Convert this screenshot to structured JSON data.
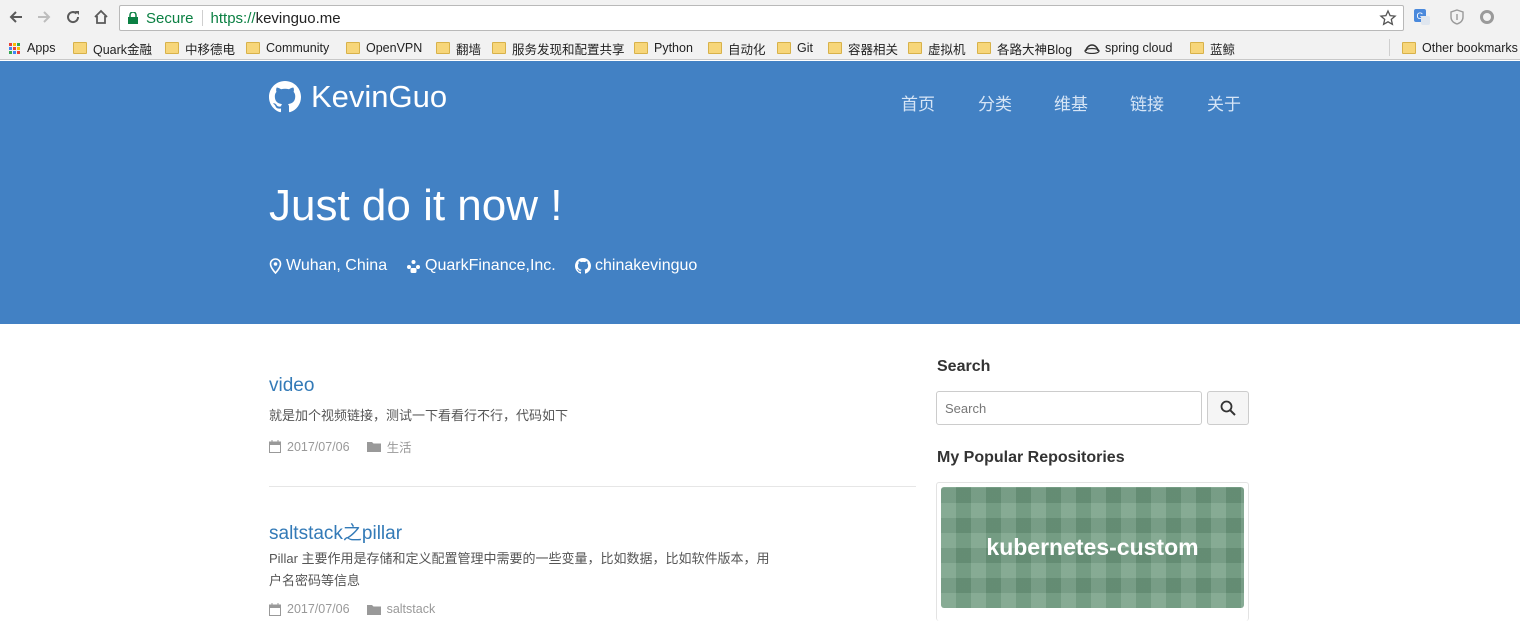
{
  "browser": {
    "secure_label": "Secure",
    "url_scheme": "https://",
    "url_host": "kevinguo.me",
    "bookmarks": [
      "Apps",
      "Quark金融",
      "中移德电",
      "Community",
      "OpenVPN",
      "翻墙",
      "服务发现和配置共享",
      "Python",
      "自动化",
      "Git",
      "容器相关",
      "虚拟机",
      "各路大神Blog",
      "spring cloud",
      "蓝鲸"
    ],
    "other_bookmarks": "Other bookmarks"
  },
  "site": {
    "brand": "KevinGuo",
    "nav": [
      "首页",
      "分类",
      "维基",
      "链接",
      "关于"
    ],
    "slogan": "Just do it now !",
    "location": "Wuhan, China",
    "company": "QuarkFinance,Inc.",
    "github": "chinakevinguo"
  },
  "posts": [
    {
      "title": "video",
      "excerpt": "就是加个视频链接，测试一下看看行不行，代码如下",
      "date": "2017/07/06",
      "category": "生活"
    },
    {
      "title": "saltstack之pillar",
      "excerpt_line1": "Pillar 主要作用是存储和定义配置管理中需要的一些变量，比如数据，比如软件版本，用",
      "excerpt_line2": "户名密码等信息",
      "date": "2017/07/06",
      "category": "saltstack"
    }
  ],
  "sidebar": {
    "search_heading": "Search",
    "search_placeholder": "Search",
    "repos_heading": "My Popular Repositories",
    "repo_name": "kubernetes-custom"
  },
  "colors": {
    "header_bg": "#4281c4",
    "link": "#337ab7",
    "secure_green": "#0b8043",
    "repo_bg": "#6e9a7e"
  }
}
